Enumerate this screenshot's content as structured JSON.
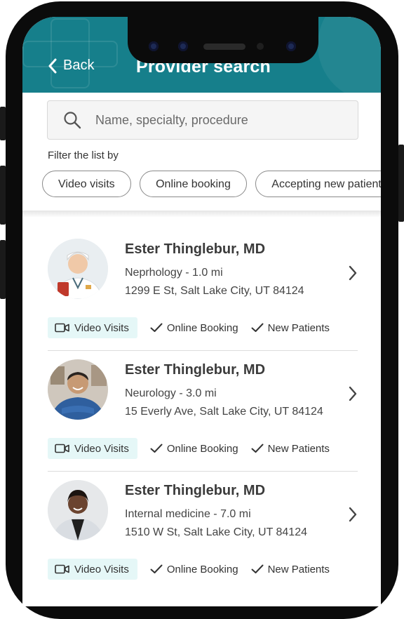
{
  "header": {
    "back_label": "Back",
    "title": "Provider search"
  },
  "search": {
    "placeholder": "Name, specialty, procedure"
  },
  "filters": {
    "label": "Filter the list by",
    "chips": [
      "Video visits",
      "Online booking",
      "Accepting new patients"
    ]
  },
  "providers": [
    {
      "name": "Ester Thinglebur, MD",
      "specialty": "Neprhology - 1.0 mi",
      "address": "1299 E St, Salt Lake City, UT 84124",
      "video": "Video Visits",
      "booking": "Online Booking",
      "patients": "New Patients"
    },
    {
      "name": "Ester Thinglebur, MD",
      "specialty": "Neurology - 3.0 mi",
      "address": "15 Everly Ave, Salt Lake City, UT 84124",
      "video": "Video Visits",
      "booking": "Online Booking",
      "patients": "New Patients"
    },
    {
      "name": "Ester Thinglebur, MD",
      "specialty": "Internal medicine - 7.0 mi",
      "address": "1510 W St, Salt Lake City, UT 84124",
      "video": "Video Visits",
      "booking": "Online Booking",
      "patients": "New Patients"
    }
  ],
  "colors": {
    "header": "#167f8b",
    "badge_bg": "#e5f7f7"
  },
  "icons": [
    "back-chevron-icon",
    "search-icon",
    "video-camera-icon",
    "check-icon",
    "chevron-right-icon"
  ]
}
